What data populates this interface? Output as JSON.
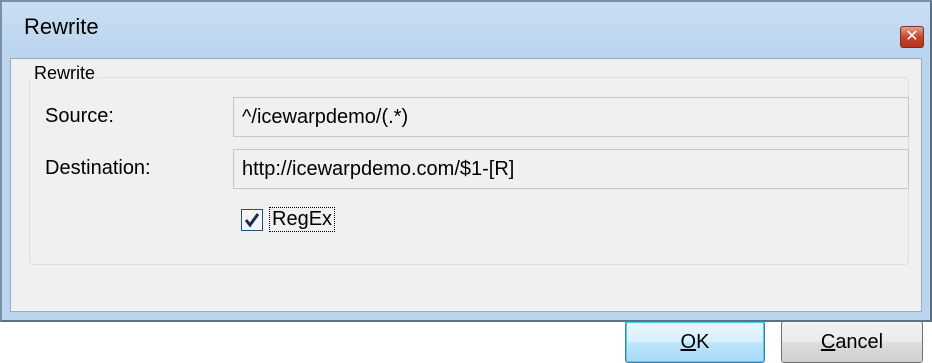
{
  "window": {
    "title": "Rewrite"
  },
  "group": {
    "legend": "Rewrite"
  },
  "source": {
    "label": "Source:",
    "value": "^/icewarpdemo/(.*)"
  },
  "destination": {
    "label": "Destination:",
    "value": "http://icewarpdemo.com/$1-[R]"
  },
  "regex": {
    "label": "RegEx",
    "checked": true
  },
  "buttons": {
    "ok_mnemonic": "O",
    "ok_rest": "K",
    "cancel_mnemonic": "C",
    "cancel_rest": "ancel"
  },
  "icons": {
    "close": "close-icon",
    "check": "checkmark-icon"
  },
  "colors": {
    "titlebar": "#c2dbf2",
    "close": "#c7452c",
    "default_button": "#a7d9f5"
  }
}
